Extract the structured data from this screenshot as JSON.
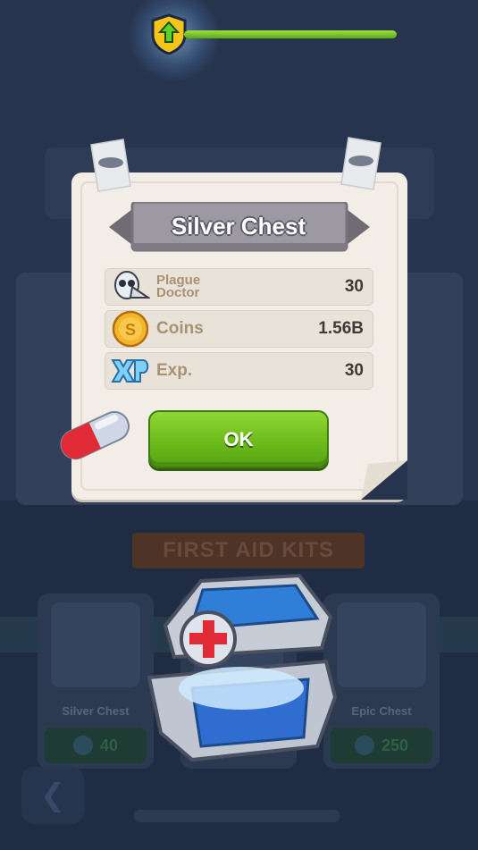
{
  "top_bar": {
    "level_icon": "up-arrow-shield-icon",
    "xp_progress": 1.0,
    "xp_color": "#7fcf2a"
  },
  "dialog": {
    "title": "Silver Chest",
    "rewards": [
      {
        "icon": "plague-doctor-mask-icon",
        "label": "Plague Doctor",
        "value": "30"
      },
      {
        "icon": "coin-icon",
        "label": "Coins",
        "value": "1.56B"
      },
      {
        "icon": "xp-icon",
        "label": "Exp.",
        "value": "30"
      }
    ],
    "ok_label": "OK",
    "decor_icons": [
      "pill-capsule-icon",
      "silver-medkit-chest-icon"
    ]
  },
  "background_shop": {
    "section_title": "FIRST AID KITS",
    "cards": [
      {
        "name": "Silver Chest",
        "price": "40"
      },
      {
        "name": "",
        "price": ""
      },
      {
        "name": "Epic Chest",
        "price": "250"
      }
    ],
    "back_icon": "back-arrow-icon"
  },
  "colors": {
    "ok_green": "#6cbc1c",
    "dialog_bg": "#f2ede6",
    "label_tan": "#a99273"
  }
}
